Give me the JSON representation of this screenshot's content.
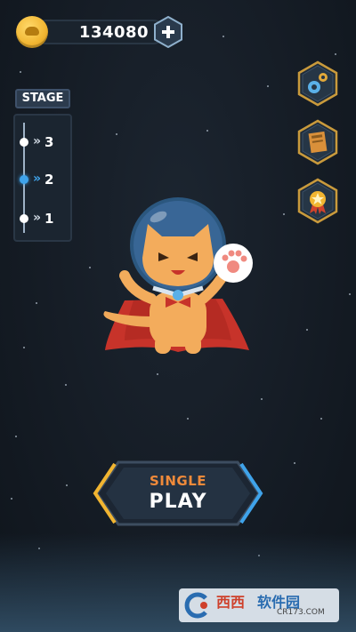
{
  "currency": {
    "amount": "134080",
    "icon": "coin-icon",
    "add_icon": "plus-icon"
  },
  "stage": {
    "label": "STAGE",
    "levels": [
      {
        "number": "3",
        "active": false
      },
      {
        "number": "2",
        "active": true
      },
      {
        "number": "1",
        "active": false
      }
    ],
    "active_color": "#3fa3ea"
  },
  "side_buttons": [
    {
      "name": "settings",
      "icon": "gears-icon"
    },
    {
      "name": "book",
      "icon": "book-icon"
    },
    {
      "name": "achievements",
      "icon": "star-medal-icon"
    }
  ],
  "play_button": {
    "mode": "SINGLE",
    "label": "PLAY",
    "accent": "#f08a3a"
  },
  "watermark": {
    "brand_a": "西西",
    "brand_b": "软件园",
    "url": "CR173.COM"
  },
  "colors": {
    "background": "#151c25",
    "accent_blue": "#3fa3ea",
    "hex_frame": "#c99a3c"
  }
}
